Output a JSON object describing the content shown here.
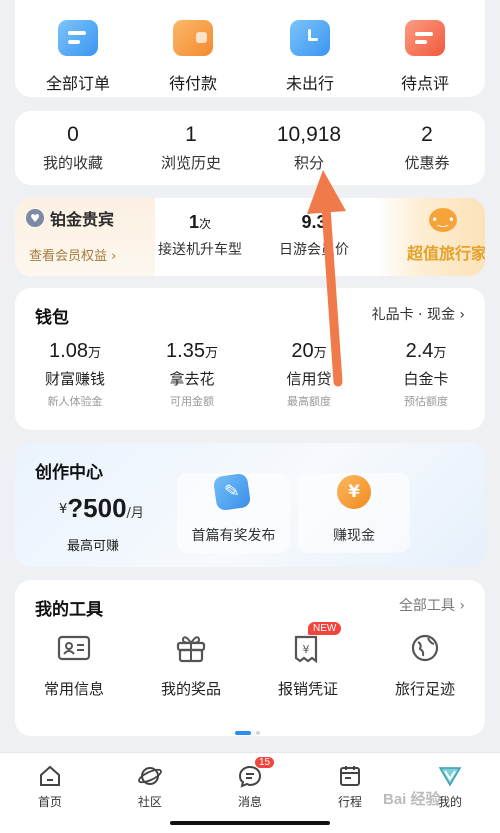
{
  "orders": [
    {
      "label": "全部订单",
      "icon": "all-orders-icon",
      "color": "#3aa0f5"
    },
    {
      "label": "待付款",
      "icon": "wallet-icon",
      "color": "#f7923b"
    },
    {
      "label": "未出行",
      "icon": "clock-icon",
      "color": "#3aa0f5"
    },
    {
      "label": "待点评",
      "icon": "comment-icon",
      "color": "#f56a4f"
    }
  ],
  "stats": [
    {
      "value": "0",
      "label": "我的收藏"
    },
    {
      "value": "1",
      "label": "浏览历史"
    },
    {
      "value": "10,918",
      "label": "积分"
    },
    {
      "value": "2",
      "label": "优惠券"
    }
  ],
  "member": {
    "level": "铂金贵宾",
    "link": "查看会员权益 ›",
    "perks": [
      {
        "value": "1",
        "unit": "次",
        "label": "接送机升车型"
      },
      {
        "value": "9.3",
        "unit": "",
        "label": "日游会员价"
      }
    ],
    "super_label": "超值旅行家"
  },
  "wallet": {
    "title": "钱包",
    "link": "礼品卡 · 现金 ›",
    "items": [
      {
        "value": "1.08",
        "unit": "万",
        "label": "财富赚钱",
        "sub": "新人体验金"
      },
      {
        "value": "1.35",
        "unit": "万",
        "label": "拿去花",
        "sub": "可用金额"
      },
      {
        "value": "20",
        "unit": "万",
        "label": "信用贷",
        "sub": "最高额度"
      },
      {
        "value": "2.4",
        "unit": "万",
        "label": "白金卡",
        "sub": "预估额度"
      }
    ]
  },
  "create": {
    "title": "创作中心",
    "yen": "¥",
    "amount": "?500",
    "per": "/月",
    "amount_label": "最高可赚",
    "btn1": "首篇有奖发布",
    "btn2": "赚现金",
    "coin_glyph": "¥"
  },
  "tools": {
    "title": "我的工具",
    "link": "全部工具 ›",
    "items": [
      {
        "label": "常用信息",
        "icon": "id-card-icon"
      },
      {
        "label": "我的奖品",
        "icon": "gift-icon"
      },
      {
        "label": "报销凭证",
        "icon": "receipt-icon",
        "badge": "NEW"
      },
      {
        "label": "旅行足迹",
        "icon": "globe-icon"
      }
    ]
  },
  "tabbar": [
    {
      "label": "首页",
      "icon": "home-icon"
    },
    {
      "label": "社区",
      "icon": "planet-icon"
    },
    {
      "label": "消息",
      "icon": "message-icon",
      "badge": "15"
    },
    {
      "label": "行程",
      "icon": "calendar-icon"
    },
    {
      "label": "我的",
      "icon": "profile-icon"
    }
  ],
  "watermark": "Bai 经验",
  "colors": {
    "accent": "#2d8cf0",
    "badge": "#f0443c",
    "arrow": "#f07a4a",
    "gold": "#e5a12b"
  }
}
